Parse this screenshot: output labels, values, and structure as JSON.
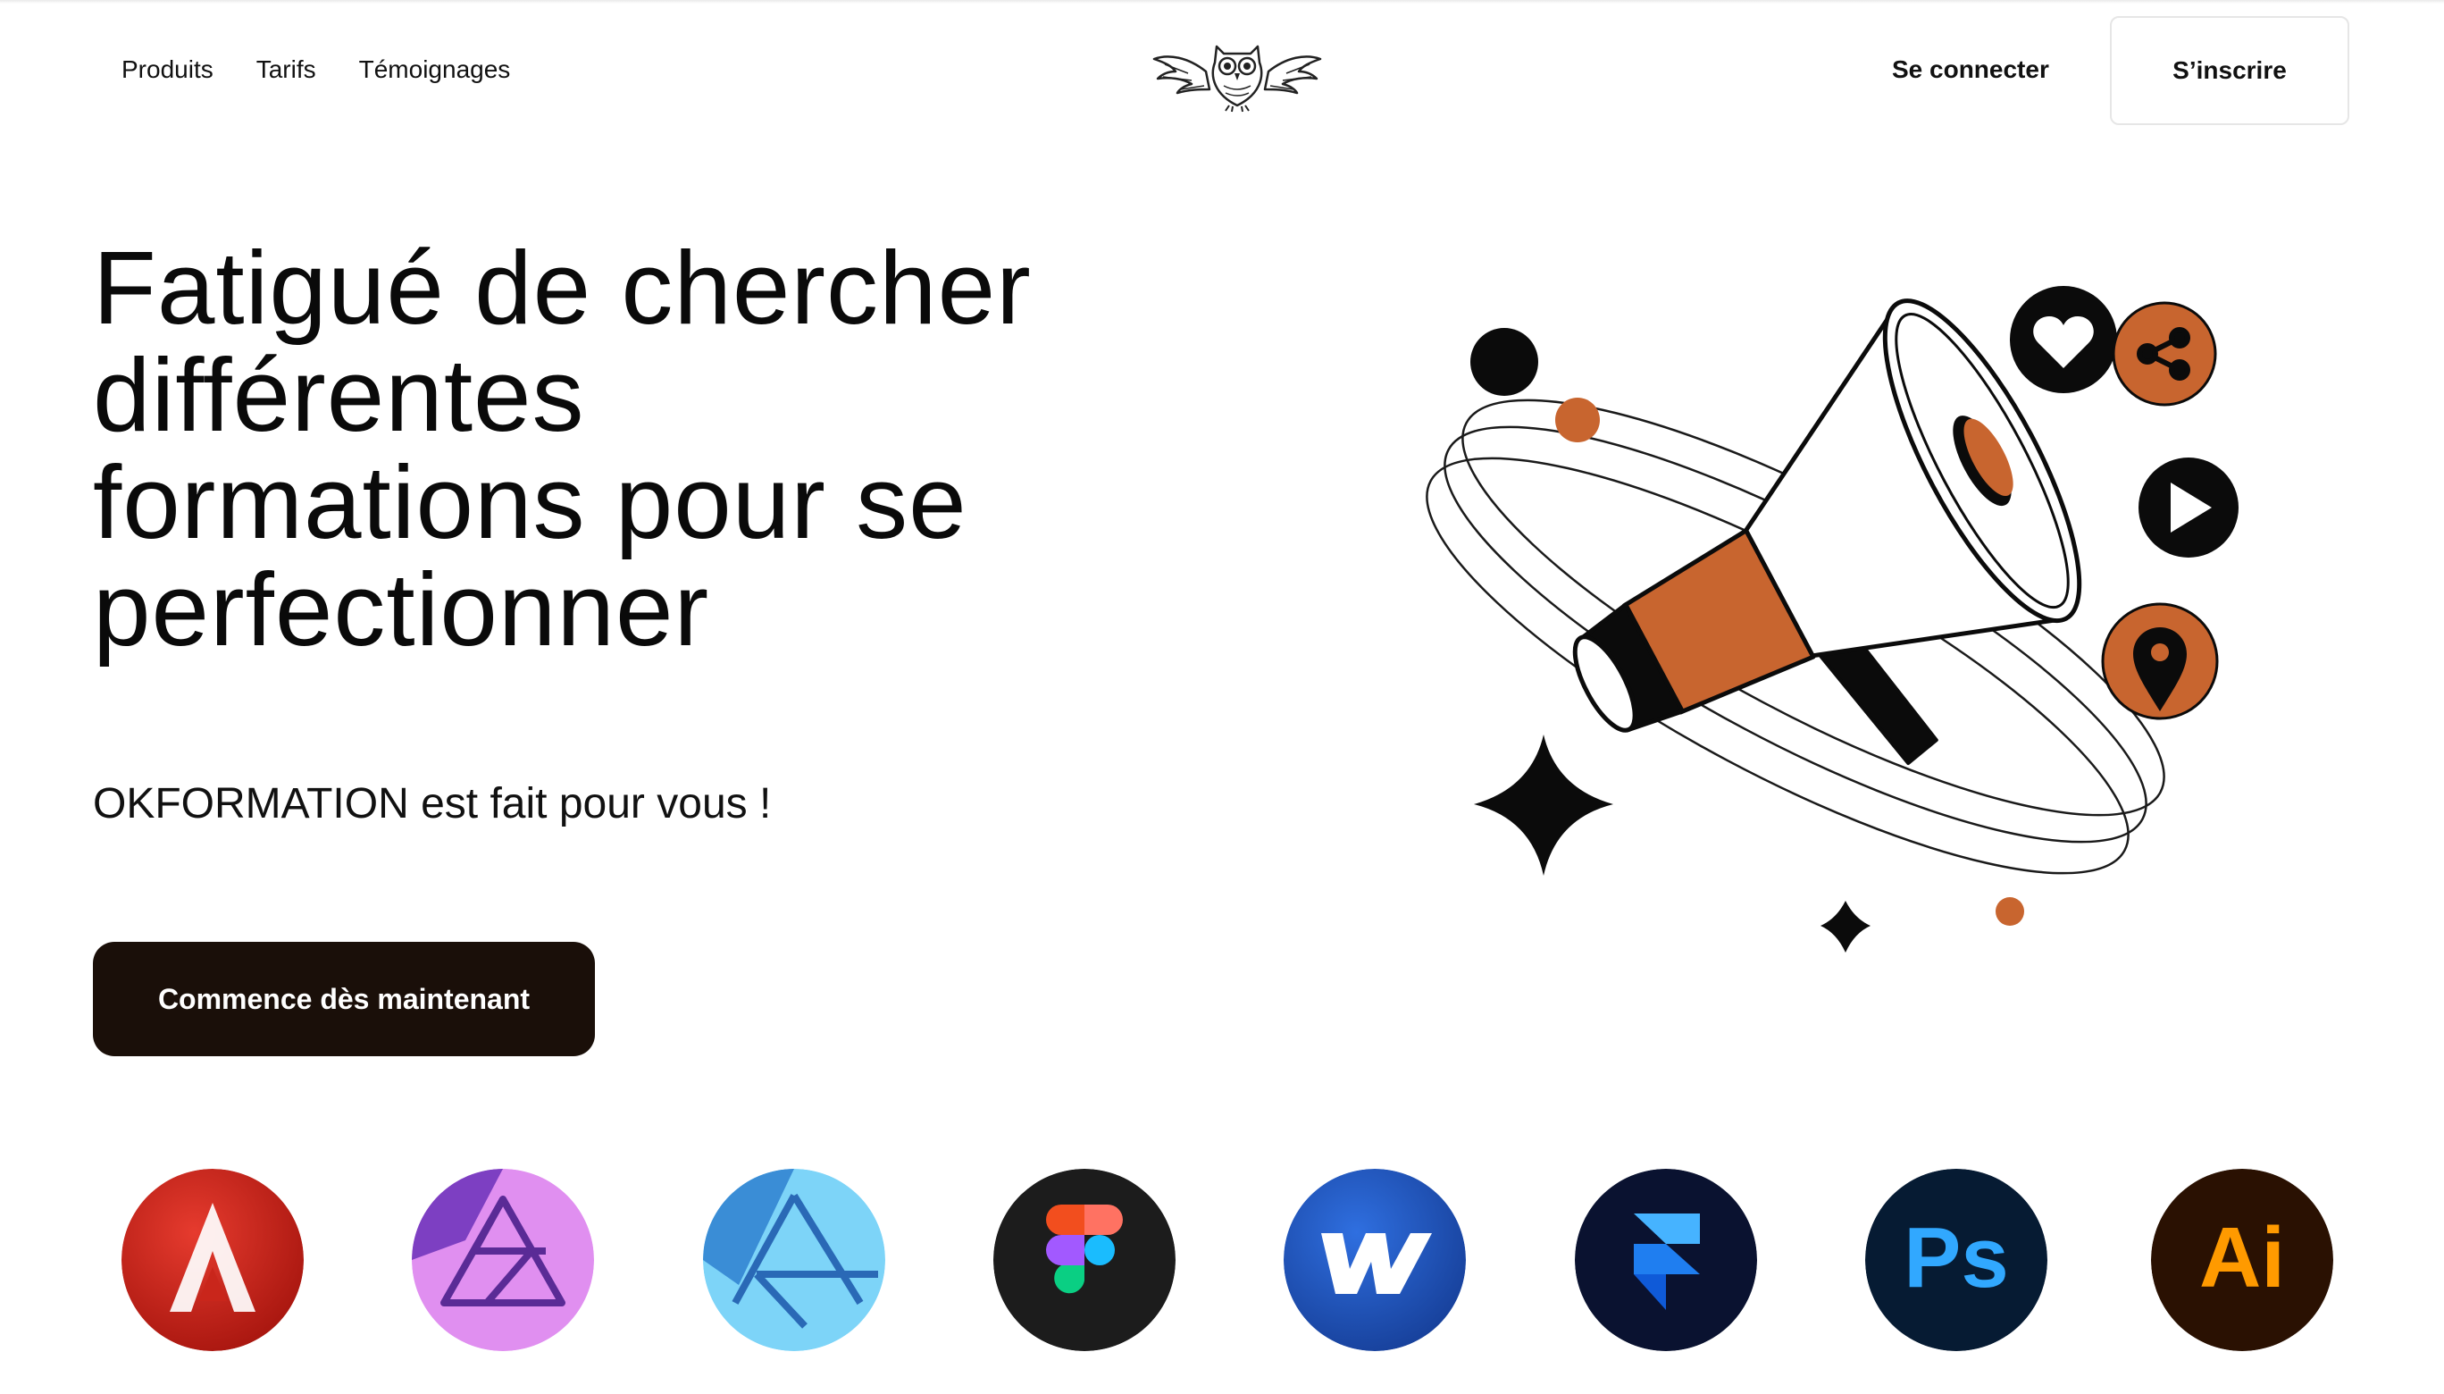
{
  "nav": {
    "links": [
      "Produits",
      "Tarifs",
      "Témoignages"
    ],
    "login_label": "Se connecter",
    "signup_label": "S’inscrire",
    "logo_icon": "owl-logo-icon"
  },
  "hero": {
    "title_lines": [
      "Fatigué de chercher",
      "différentes",
      "formations pour se",
      "perfectionner"
    ],
    "subtitle": "OKFORMATION est fait pour vous !",
    "cta_label": "Commence dès maintenant",
    "illustration_icon": "megaphone-illustration"
  },
  "tools": {
    "icons": [
      {
        "name": "adobe-icon",
        "text": ""
      },
      {
        "name": "affinity-photo-icon",
        "text": ""
      },
      {
        "name": "affinity-designer-icon",
        "text": ""
      },
      {
        "name": "figma-icon",
        "text": ""
      },
      {
        "name": "webflow-icon",
        "text": ""
      },
      {
        "name": "framer-icon",
        "text": ""
      },
      {
        "name": "photoshop-icon",
        "text": "Ps"
      },
      {
        "name": "illustrator-icon",
        "text": "Ai"
      }
    ]
  },
  "colors": {
    "accent": "#c8652f",
    "cta_bg": "#1a0f09",
    "text": "#0b0b0b"
  }
}
